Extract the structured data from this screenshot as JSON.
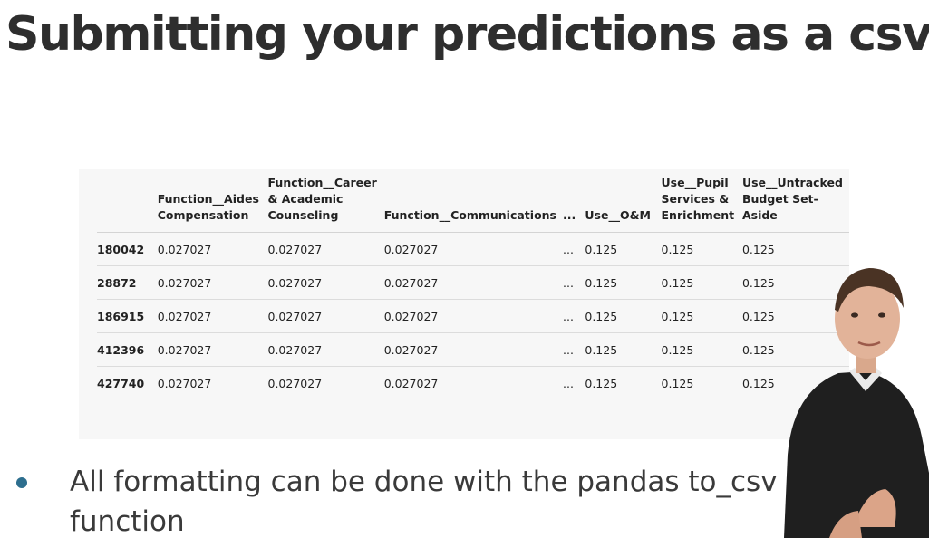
{
  "slide": {
    "title": "Submitting your predictions as a csv",
    "bullet": "All formatting can be done with the pandas to_csv function"
  },
  "table": {
    "columns": [
      "",
      "Function__Aides Compensation",
      "Function__Career & Academic Counseling",
      "Function__Communications",
      "...",
      "Use__O&M",
      "Use__Pupil Services & Enrichment",
      "Use__Untracked Budget Set-Aside"
    ],
    "rows": [
      [
        "180042",
        "0.027027",
        "0.027027",
        "0.027027",
        "...",
        "0.125",
        "0.125",
        "0.125"
      ],
      [
        "28872",
        "0.027027",
        "0.027027",
        "0.027027",
        "...",
        "0.125",
        "0.125",
        "0.125"
      ],
      [
        "186915",
        "0.027027",
        "0.027027",
        "0.027027",
        "...",
        "0.125",
        "0.125",
        "0.125"
      ],
      [
        "412396",
        "0.027027",
        "0.027027",
        "0.027027",
        "...",
        "0.125",
        "0.125",
        "0.125"
      ],
      [
        "427740",
        "0.027027",
        "0.027027",
        "0.027027",
        "...",
        "0.125",
        "0.125",
        "0.125"
      ]
    ]
  },
  "colors": {
    "bullet": "#2d6e8e",
    "title": "#2e2e2e",
    "table_bg": "#f7f7f7"
  },
  "icons": {
    "bullet": "bullet-dot-icon",
    "presenter": "presenter-video-image"
  }
}
